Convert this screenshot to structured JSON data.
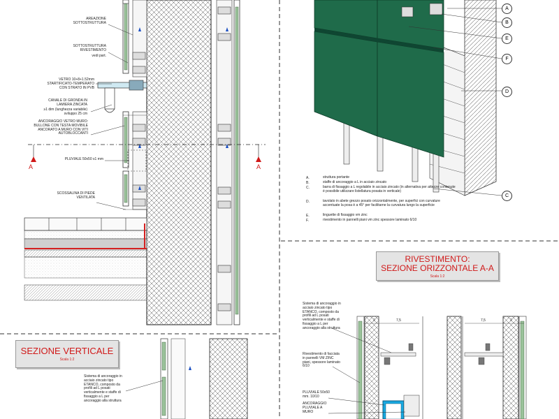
{
  "sections": {
    "vertical": {
      "title": "SEZIONE VERTICALE",
      "scale": "Scala 1:2"
    },
    "horizontal": {
      "title_line1": "RIVESTIMENTO:",
      "title_line2": "SEZIONE ORIZZONTALE A-A",
      "scale": "Scala 1:2"
    }
  },
  "section_marks": {
    "left": "A",
    "right": "A"
  },
  "vertical_labels": {
    "areazione": "AREAZIONE\nSOTTOSTRUTTURA",
    "sottostruttura": "SOTTOSTRUTTURA\nRIVESTIMENTO",
    "vedi_part": "vedi part.",
    "vetro": "VETRO 10+8+1.52mm\nSTARTIFICATO-TEMPERATO\nCON STRATO IN PVB",
    "canale": "CANALE DI GRONDA IN\nLAMIERA ZINCATA",
    "canale_dim": "≥1 dim (lunghezza variabile)\nsviluppo 25 cm",
    "ancoraggio_vetro": "ANCORAGGIO VETRO MURO:\nBULLONE CON TESTA MOVIBILE\nANCORATO A MURO CON VITI\nAUTOBLOCCANTI",
    "pluviale": "PLUVIALE  50x50 s1 mm",
    "scossalina": "SCOSSALINA DI PIEDE\nVENTILATA",
    "sistema": "Sistema di ancoraggio in\nacciaio zincato tipo\nETANCO, composto da\nprofili  ad L posati\nverticalmente  e staffe di\nfissaggio a L per\nancoraggio alla struttura"
  },
  "axon_callouts": [
    "A",
    "B",
    "E",
    "F",
    "D",
    "C"
  ],
  "legend": [
    {
      "key": "A.",
      "text": "struttura portante"
    },
    {
      "key": "B.",
      "text": "staffe di ancoraggio a L in acciaio zincato"
    },
    {
      "key": "C.",
      "text": "barra di fissaggio  a L regolabile in acciaio zincato (in alternativa per attezze contenute è possibile utilizzare listellatura posata in verticale)"
    },
    {
      "key": "D.",
      "text": "tavolato in abete grezzo posato orizzontalmente, per superfici con curvature accentuate la posa è a 45° per facilitarne la curvatura lungo la superficie"
    },
    {
      "key": "E.",
      "text": "linguette di fissaggio vm zinc"
    },
    {
      "key": "F.",
      "text": "rivestimento in pannelli piani vm zinc spessore laminato 6/10"
    }
  ],
  "horizontal_labels": {
    "sistema": "Sistema di ancoraggio in\nacciaio zincato tipo\nETANCO, composto da\nprofili  ad L posati\nverticalmente  e staffe di\nfissaggio a L per\nancoraggio alla struttura",
    "rivestimento": "Rivestimento di facciata\nin pannelli VM ZINC\npiani, spessore laminato\n6/10",
    "pluviale": "PLUVIALE 50x50\nmm. 10/10",
    "ancoraggio": "ANCORAGGIO\nPLUVIALE A\nMURO",
    "dim_left": "7,5",
    "dim_right": "7,5",
    "dim_small_l": "2",
    "dim_small_r": "2"
  },
  "colors": {
    "title_red": "#d01818",
    "panel_green": "#1f6b4a",
    "pluviale_blue": "#19a9e1",
    "wall_red": "#d42020"
  }
}
